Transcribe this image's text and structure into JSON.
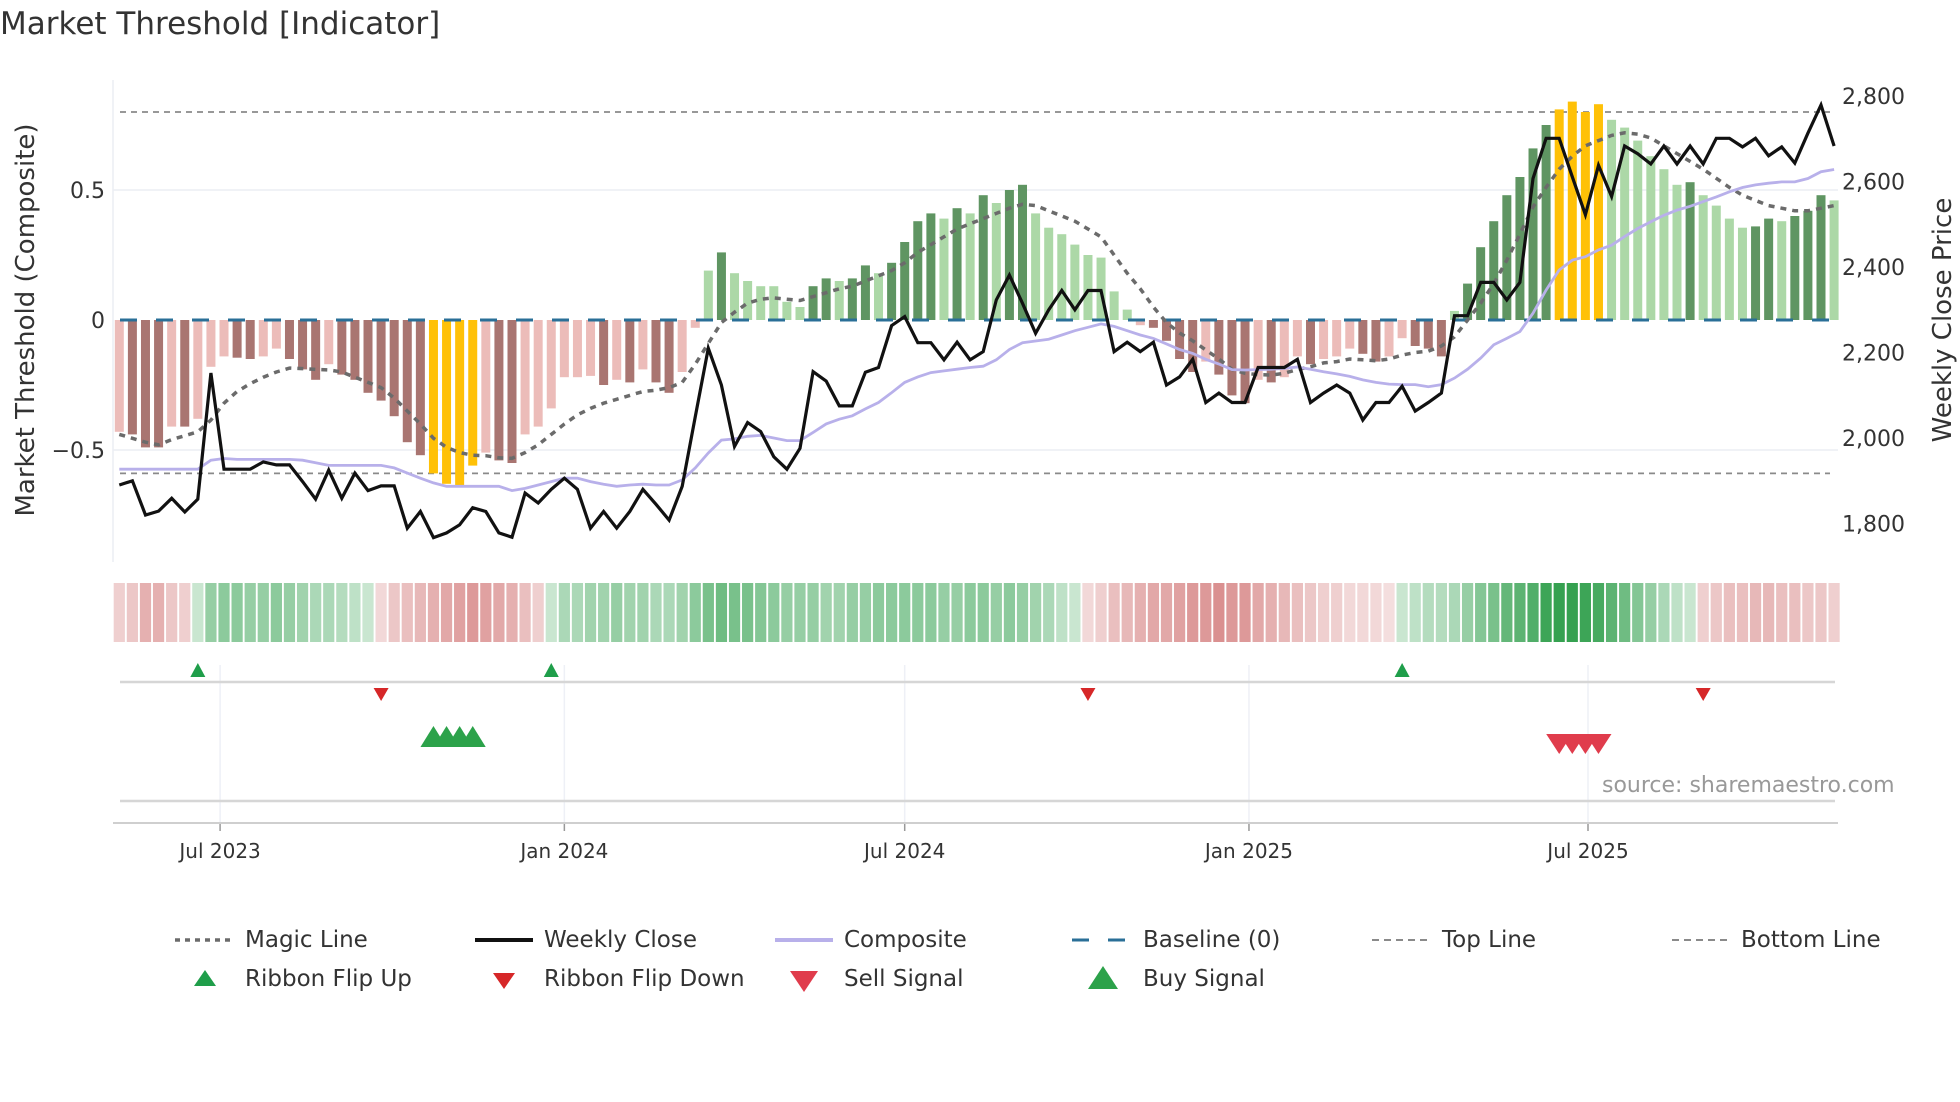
{
  "title": "Market Threshold [Indicator]",
  "source": "source: sharemaestro.com",
  "colors": {
    "bar_dark_red": "#a97571",
    "bar_light_red": "#ecbcb9",
    "bar_dark_green": "#5f9562",
    "bar_light_green": "#acd8a7",
    "bar_extreme": "#ffc107",
    "magic_line": "#6b6b6b",
    "weekly_close": "#111111",
    "composite": "#b8b0ea",
    "baseline": "#2a6f97",
    "threshold_lines": "#8a8a8a",
    "ribbon_green": "#2e9e4a",
    "ribbon_red": "#c85a5a",
    "flip_up": "#1f9e4a",
    "flip_down": "#d62728",
    "buy": "#2ca24a",
    "sell": "#e03c4c"
  },
  "legend": [
    {
      "label": "Magic Line",
      "icon": "dotted-line"
    },
    {
      "label": "Weekly Close",
      "icon": "solid-black-line"
    },
    {
      "label": "Composite",
      "icon": "lavender-line"
    },
    {
      "label": "Baseline (0)",
      "icon": "dashed-blue-line"
    },
    {
      "label": "Top Line",
      "icon": "dashed-gray-line"
    },
    {
      "label": "Bottom Line",
      "icon": "dashed-gray-line"
    },
    {
      "label": "Ribbon Flip Up",
      "icon": "triangle-up-small"
    },
    {
      "label": "Ribbon Flip Down",
      "icon": "triangle-down-small"
    },
    {
      "label": "Sell Signal",
      "icon": "triangle-down-large"
    },
    {
      "label": "Buy Signal",
      "icon": "triangle-up-large"
    }
  ],
  "chart_data": {
    "type": "bar+line",
    "title": "Market Threshold [Indicator]",
    "x_unit": "week index (weekly)",
    "x_ticks": [
      {
        "label": "Jul 2023",
        "x": 7.7
      },
      {
        "label": "Jan 2024",
        "x": 34.0
      },
      {
        "label": "Jul 2024",
        "x": 60.0
      },
      {
        "label": "Jan 2025",
        "x": 86.3
      },
      {
        "label": "Jul 2025",
        "x": 112.2
      }
    ],
    "left_axis": {
      "label": "Market Threshold (Composite)",
      "ylim": [
        -0.85,
        0.92
      ],
      "ticks": [
        0.5,
        0,
        -0.5
      ],
      "tick_labels": [
        "0.5",
        "0",
        "−0.5"
      ]
    },
    "right_axis": {
      "label": "Weekly Close Price",
      "ylim": [
        1700,
        2840
      ],
      "ticks": [
        2800,
        2600,
        2400,
        2200,
        2000,
        1800
      ],
      "tick_labels": [
        "2,800",
        "2,600",
        "2,400",
        "2,200",
        "2,000",
        "1,800"
      ]
    },
    "top_line": 0.8,
    "bottom_line": -0.59,
    "baseline": 0,
    "composite_bars": [
      -0.43,
      -0.44,
      -0.49,
      -0.49,
      -0.41,
      -0.41,
      -0.38,
      -0.18,
      -0.14,
      -0.145,
      -0.15,
      -0.14,
      -0.11,
      -0.15,
      -0.19,
      -0.23,
      -0.17,
      -0.21,
      -0.23,
      -0.28,
      -0.31,
      -0.37,
      -0.47,
      -0.52,
      -0.59,
      -0.63,
      -0.64,
      -0.56,
      -0.51,
      -0.54,
      -0.55,
      -0.44,
      -0.41,
      -0.34,
      -0.22,
      -0.22,
      -0.215,
      -0.25,
      -0.23,
      -0.24,
      -0.19,
      -0.24,
      -0.28,
      -0.2,
      -0.03,
      0.19,
      0.26,
      0.18,
      0.15,
      0.13,
      0.13,
      0.07,
      0.05,
      0.13,
      0.16,
      0.15,
      0.16,
      0.21,
      0.18,
      0.22,
      0.3,
      0.38,
      0.41,
      0.39,
      0.43,
      0.41,
      0.48,
      0.45,
      0.5,
      0.52,
      0.41,
      0.355,
      0.33,
      0.29,
      0.25,
      0.24,
      0.11,
      0.04,
      -0.02,
      -0.03,
      -0.08,
      -0.15,
      -0.2,
      -0.16,
      -0.21,
      -0.29,
      -0.32,
      -0.23,
      -0.24,
      -0.22,
      -0.14,
      -0.17,
      -0.15,
      -0.14,
      -0.11,
      -0.13,
      -0.16,
      -0.14,
      -0.07,
      -0.1,
      -0.11,
      -0.14,
      0.035,
      0.14,
      0.28,
      0.38,
      0.48,
      0.55,
      0.66,
      0.75,
      0.81,
      0.84,
      0.8,
      0.83,
      0.77,
      0.74,
      0.69,
      0.63,
      0.58,
      0.52,
      0.53,
      0.48,
      0.44,
      0.39,
      0.355,
      0.36,
      0.39,
      0.38,
      0.4,
      0.42,
      0.48,
      0.46
    ],
    "bar_colors": [
      "lr",
      "dr",
      "dr",
      "dr",
      "lr",
      "dr",
      "lr",
      "lr",
      "lr",
      "dr",
      "dr",
      "lr",
      "lr",
      "dr",
      "dr",
      "dr",
      "lr",
      "dr",
      "dr",
      "dr",
      "dr",
      "dr",
      "dr",
      "dr",
      "y",
      "y",
      "y",
      "y",
      "lr",
      "dr",
      "dr",
      "lr",
      "lr",
      "lr",
      "lr",
      "lr",
      "lr",
      "dr",
      "lr",
      "dr",
      "lr",
      "dr",
      "dr",
      "lr",
      "lr",
      "lg",
      "dg",
      "lg",
      "lg",
      "lg",
      "lg",
      "lg",
      "lg",
      "dg",
      "dg",
      "lg",
      "dg",
      "dg",
      "lg",
      "dg",
      "dg",
      "dg",
      "dg",
      "lg",
      "dg",
      "lg",
      "dg",
      "lg",
      "dg",
      "dg",
      "lg",
      "lg",
      "lg",
      "lg",
      "lg",
      "lg",
      "lg",
      "lg",
      "lr",
      "dr",
      "dr",
      "dr",
      "dr",
      "lr",
      "dr",
      "dr",
      "dr",
      "lr",
      "dr",
      "lr",
      "lr",
      "dr",
      "lr",
      "lr",
      "lr",
      "dr",
      "dr",
      "lr",
      "lr",
      "dr",
      "dr",
      "dr",
      "lg",
      "dg",
      "dg",
      "dg",
      "dg",
      "dg",
      "dg",
      "dg",
      "y",
      "y",
      "y",
      "y",
      "lg",
      "lg",
      "lg",
      "lg",
      "lg",
      "lg",
      "dg",
      "lg",
      "lg",
      "lg",
      "lg",
      "dg",
      "dg",
      "lg",
      "dg",
      "dg",
      "dg",
      "lg"
    ],
    "magic_line": [
      -0.44,
      -0.455,
      -0.47,
      -0.48,
      -0.46,
      -0.445,
      -0.43,
      -0.385,
      -0.32,
      -0.275,
      -0.245,
      -0.22,
      -0.2,
      -0.185,
      -0.187,
      -0.19,
      -0.192,
      -0.2,
      -0.22,
      -0.24,
      -0.26,
      -0.3,
      -0.35,
      -0.4,
      -0.455,
      -0.49,
      -0.51,
      -0.52,
      -0.522,
      -0.53,
      -0.532,
      -0.51,
      -0.48,
      -0.44,
      -0.4,
      -0.365,
      -0.34,
      -0.32,
      -0.305,
      -0.29,
      -0.275,
      -0.27,
      -0.26,
      -0.24,
      -0.17,
      -0.09,
      -0.01,
      0.03,
      0.065,
      0.08,
      0.085,
      0.08,
      0.075,
      0.09,
      0.105,
      0.12,
      0.13,
      0.15,
      0.17,
      0.19,
      0.22,
      0.26,
      0.29,
      0.32,
      0.35,
      0.37,
      0.39,
      0.41,
      0.43,
      0.445,
      0.44,
      0.42,
      0.4,
      0.38,
      0.35,
      0.32,
      0.25,
      0.18,
      0.12,
      0.05,
      -0.01,
      -0.05,
      -0.08,
      -0.115,
      -0.15,
      -0.19,
      -0.205,
      -0.21,
      -0.212,
      -0.205,
      -0.19,
      -0.18,
      -0.165,
      -0.16,
      -0.15,
      -0.153,
      -0.157,
      -0.15,
      -0.135,
      -0.125,
      -0.12,
      -0.1,
      -0.065,
      0,
      0.065,
      0.14,
      0.23,
      0.33,
      0.435,
      0.51,
      0.58,
      0.63,
      0.67,
      0.69,
      0.71,
      0.72,
      0.715,
      0.7,
      0.67,
      0.64,
      0.61,
      0.58,
      0.545,
      0.51,
      0.48,
      0.46,
      0.44,
      0.43,
      0.42,
      0.42,
      0.43,
      0.44
    ],
    "weekly_close": [
      1890,
      1900,
      1820,
      1829,
      1859,
      1827,
      1857,
      2152,
      1927,
      1927,
      1927,
      1944,
      1937,
      1937,
      1898,
      1857,
      1925,
      1859,
      1918,
      1877,
      1888,
      1888,
      1789,
      1828,
      1767,
      1778,
      1797,
      1837,
      1828,
      1778,
      1768,
      1871,
      1848,
      1880,
      1906,
      1880,
      1789,
      1828,
      1789,
      1828,
      1880,
      1845,
      1808,
      1887,
      2050,
      2210,
      2124,
      1980,
      2036,
      2015,
      1956,
      1927,
      1976,
      2155,
      2133,
      2075,
      2075,
      2154,
      2165,
      2263,
      2284,
      2223,
      2223,
      2183,
      2224,
      2183,
      2202,
      2323,
      2381,
      2315,
      2245,
      2300,
      2345,
      2300,
      2345,
      2345,
      2202,
      2224,
      2202,
      2224,
      2124,
      2143,
      2184,
      2083,
      2105,
      2083,
      2083,
      2165,
      2165,
      2165,
      2184,
      2083,
      2105,
      2124,
      2105,
      2042,
      2083,
      2083,
      2121,
      2063,
      2083,
      2105,
      2286,
      2286,
      2364,
      2364,
      2323,
      2364,
      2607,
      2701,
      2701,
      2611,
      2522,
      2638,
      2565,
      2683,
      2665,
      2641,
      2683,
      2641,
      2683,
      2641,
      2701,
      2701,
      2681,
      2701,
      2660,
      2681,
      2643,
      2713,
      2779,
      2683
    ],
    "composite_line": [
      1927,
      1927,
      1927,
      1927,
      1927,
      1927,
      1927,
      1948,
      1952,
      1950,
      1950,
      1950,
      1950,
      1950,
      1948,
      1942,
      1936,
      1936,
      1936,
      1936,
      1936,
      1930,
      1918,
      1906,
      1895,
      1887,
      1887,
      1887,
      1887,
      1887,
      1877,
      1882,
      1890,
      1898,
      1906,
      1906,
      1898,
      1892,
      1887,
      1890,
      1892,
      1890,
      1890,
      1902,
      1930,
      1965,
      1995,
      1998,
      2004,
      2006,
      2000,
      1994,
      1994,
      2013,
      2033,
      2044,
      2052,
      2068,
      2083,
      2106,
      2130,
      2143,
      2153,
      2157,
      2161,
      2165,
      2168,
      2183,
      2207,
      2223,
      2227,
      2231,
      2241,
      2251,
      2259,
      2267,
      2261,
      2251,
      2241,
      2233,
      2220,
      2207,
      2198,
      2184,
      2173,
      2160,
      2159,
      2160,
      2161,
      2163,
      2166,
      2161,
      2155,
      2150,
      2144,
      2136,
      2130,
      2126,
      2125,
      2125,
      2120,
      2125,
      2140,
      2161,
      2187,
      2218,
      2233,
      2249,
      2292,
      2346,
      2393,
      2416,
      2424,
      2440,
      2451,
      2471,
      2490,
      2506,
      2521,
      2533,
      2542,
      2553,
      2564,
      2576,
      2586,
      2592,
      2596,
      2599,
      2599,
      2607,
      2623,
      2628
    ],
    "ribbon": [
      -0.2,
      -0.25,
      -0.4,
      -0.4,
      -0.25,
      -0.2,
      0.15,
      0.4,
      0.45,
      0.45,
      0.4,
      0.4,
      0.45,
      0.4,
      0.35,
      0.3,
      0.3,
      0.25,
      0.2,
      0.15,
      -0.15,
      -0.25,
      -0.3,
      -0.35,
      -0.4,
      -0.45,
      -0.5,
      -0.55,
      -0.5,
      -0.45,
      -0.4,
      -0.3,
      -0.2,
      0.15,
      0.3,
      0.3,
      0.35,
      0.35,
      0.4,
      0.35,
      0.35,
      0.3,
      0.3,
      0.35,
      0.45,
      0.55,
      0.6,
      0.55,
      0.55,
      0.5,
      0.45,
      0.4,
      0.4,
      0.4,
      0.35,
      0.35,
      0.4,
      0.4,
      0.45,
      0.45,
      0.45,
      0.45,
      0.45,
      0.4,
      0.4,
      0.45,
      0.45,
      0.4,
      0.45,
      0.4,
      0.35,
      0.3,
      0.2,
      0.15,
      -0.15,
      -0.2,
      -0.3,
      -0.35,
      -0.4,
      -0.45,
      -0.45,
      -0.5,
      -0.55,
      -0.55,
      -0.6,
      -0.55,
      -0.55,
      -0.45,
      -0.4,
      -0.35,
      -0.3,
      -0.25,
      -0.2,
      -0.2,
      -0.15,
      -0.15,
      -0.15,
      -0.1,
      0.15,
      0.2,
      0.25,
      0.25,
      0.3,
      0.4,
      0.5,
      0.55,
      0.65,
      0.7,
      0.75,
      0.85,
      0.9,
      0.9,
      0.85,
      0.8,
      0.7,
      0.6,
      0.5,
      0.4,
      0.3,
      0.2,
      0.15,
      -0.2,
      -0.25,
      -0.3,
      -0.3,
      -0.35,
      -0.35,
      -0.3,
      -0.3,
      -0.25,
      -0.25,
      -0.2
    ],
    "signals": {
      "ribbon_flip_up": [
        6,
        33,
        98
      ],
      "ribbon_flip_down": [
        20,
        74,
        121
      ],
      "buy": [
        24,
        25,
        26,
        27
      ],
      "sell": [
        110,
        111,
        112,
        113
      ]
    },
    "legend_position": "bottom"
  }
}
